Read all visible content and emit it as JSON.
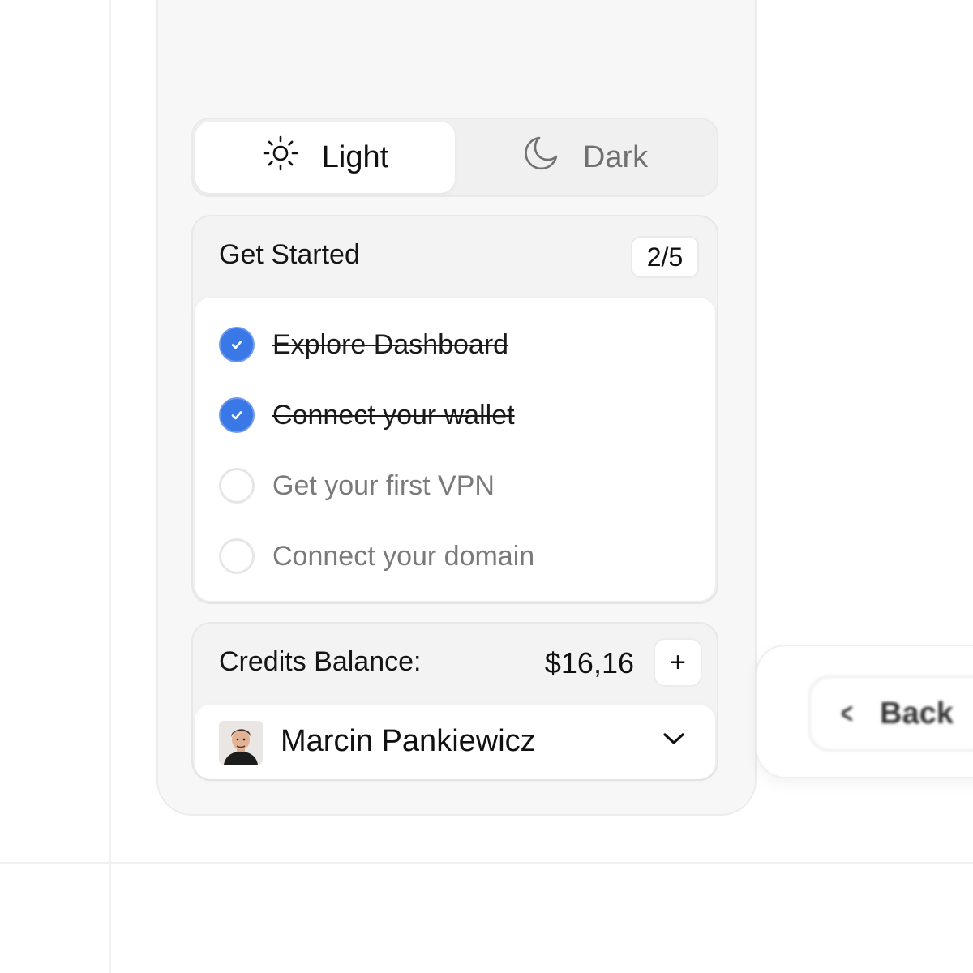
{
  "theme": {
    "options": [
      {
        "label": "Light",
        "icon": "sun-icon",
        "active": true
      },
      {
        "label": "Dark",
        "icon": "moon-icon",
        "active": false
      }
    ]
  },
  "get_started": {
    "title": "Get Started",
    "progress": "2/5",
    "tasks": [
      {
        "label": "Explore Dashboard",
        "done": true
      },
      {
        "label": "Connect your wallet",
        "done": true
      },
      {
        "label": "Get your first VPN",
        "done": false
      },
      {
        "label": "Connect your domain",
        "done": false
      }
    ]
  },
  "credits": {
    "label": "Credits Balance:",
    "value": "$16,16",
    "add_label": "+"
  },
  "user": {
    "name": "Marcin Pankiewicz"
  },
  "main": {
    "back_label": "Back"
  },
  "colors": {
    "accent": "#3b78e7",
    "done_text": "#1a1a1a",
    "todo_text": "#7a7a7a"
  }
}
